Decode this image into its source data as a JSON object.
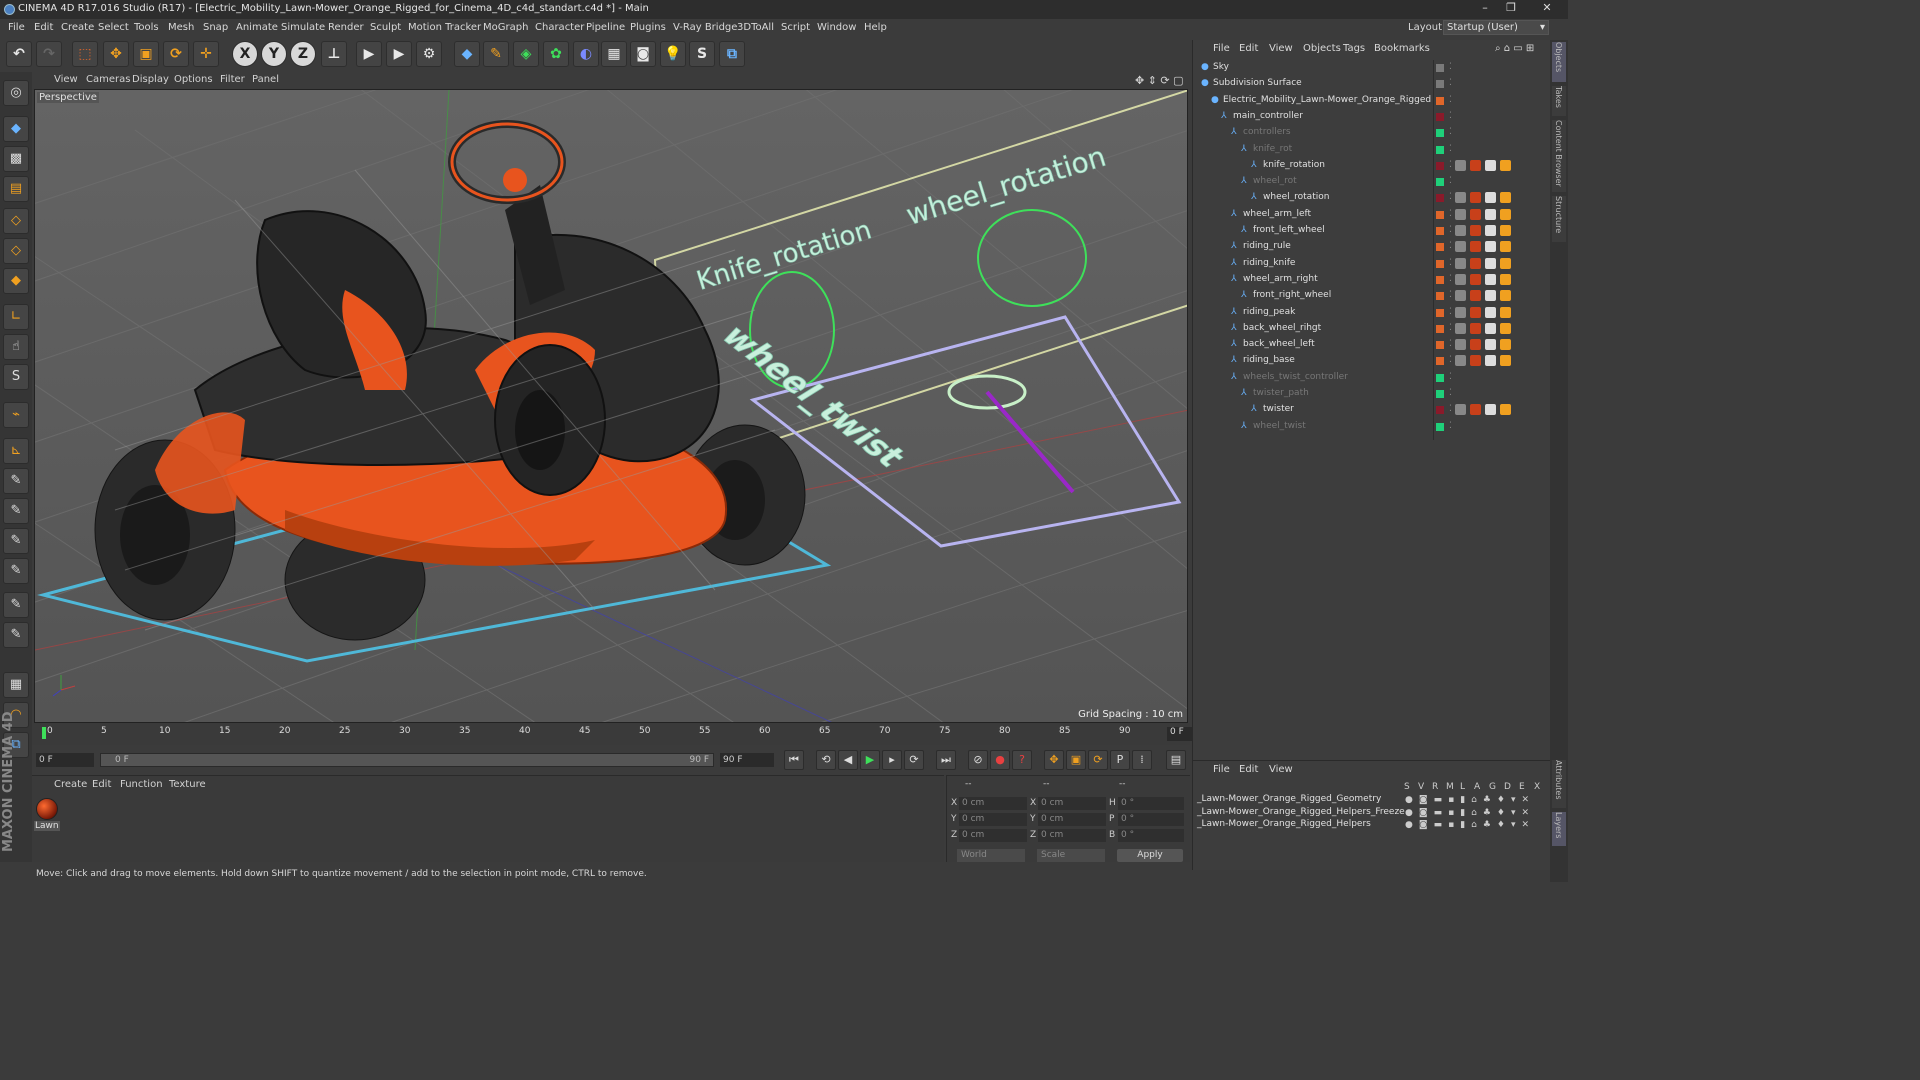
{
  "titlebar": {
    "title": "CINEMA 4D R17.016 Studio (R17) - [Electric_Mobility_Lawn-Mower_Orange_Rigged_for_Cinema_4D_c4d_standart.c4d *] - Main",
    "minimize": "–",
    "restore": "❐",
    "close": "✕"
  },
  "menubar": {
    "items": [
      "File",
      "Edit",
      "Create",
      "Select",
      "Tools",
      "Mesh",
      "Snap",
      "Animate",
      "Simulate",
      "Render",
      "Sculpt",
      "Motion Tracker",
      "MoGraph",
      "Character",
      "Pipeline",
      "Plugins",
      "V-Ray Bridge",
      "3DToAll",
      "Script",
      "Window",
      "Help"
    ],
    "layout_label": "Layout:",
    "layout_value": "Startup (User)"
  },
  "toolbar": {
    "axis_x": "X",
    "axis_y": "Y",
    "axis_z": "Z"
  },
  "viewport": {
    "menus": [
      "View",
      "Cameras",
      "Display",
      "Options",
      "Filter",
      "Panel"
    ],
    "camera_label": "Perspective",
    "grid_spacing": "Grid Spacing : 10 cm",
    "scene_text": {
      "knife_label": "Knife_rotation",
      "wheel_label": "wheel_rotation",
      "twist_label": "wheel_twist"
    }
  },
  "timeline": {
    "ticks": [
      "0",
      "5",
      "10",
      "15",
      "20",
      "25",
      "30",
      "35",
      "40",
      "45",
      "50",
      "55",
      "60",
      "65",
      "70",
      "75",
      "80",
      "85",
      "90"
    ],
    "current_frame": "0 F"
  },
  "transport": {
    "start_field": "0 F",
    "slider_start": "0 F",
    "slider_end": "90 F",
    "end_field": "90 F"
  },
  "material_panel": {
    "menus": [
      "Create",
      "Edit",
      "Function",
      "Texture"
    ],
    "material_name": "Lawn"
  },
  "coords_panel": {
    "header_pos": "--",
    "header_size": "--",
    "header_rot": "--",
    "rows": [
      {
        "axis": "X",
        "pos": "0 cm",
        "size_axis": "X",
        "size": "0 cm",
        "rot_axis": "H",
        "rot": "0 °"
      },
      {
        "axis": "Y",
        "pos": "0 cm",
        "size_axis": "Y",
        "size": "0 cm",
        "rot_axis": "P",
        "rot": "0 °"
      },
      {
        "axis": "Z",
        "pos": "0 cm",
        "size_axis": "Z",
        "size": "0 cm",
        "rot_axis": "B",
        "rot": "0 °"
      }
    ],
    "coord_system": "World",
    "mode": "Scale",
    "apply": "Apply"
  },
  "status": {
    "text": "Move: Click and drag to move elements. Hold down SHIFT to quantize movement / add to the selection in point mode, CTRL to remove."
  },
  "objects_panel": {
    "menus": [
      "File",
      "Edit",
      "View",
      "Objects",
      "Tags",
      "Bookmarks"
    ],
    "objects": [
      {
        "name": "Sky",
        "depth": 0,
        "dim": false,
        "color": "#7a7a7a"
      },
      {
        "name": "Subdivision Surface",
        "depth": 0,
        "dim": false,
        "color": "#7a7a7a"
      },
      {
        "name": "Electric_Mobility_Lawn-Mower_Orange_Rigged",
        "depth": 1,
        "dim": false,
        "color": "#e0662a"
      },
      {
        "name": "main_controller",
        "depth": 2,
        "dim": false,
        "color": "#8a1a2a"
      },
      {
        "name": "controllers",
        "depth": 3,
        "dim": true,
        "color": "#1fd07a"
      },
      {
        "name": "knife_rot",
        "depth": 4,
        "dim": true,
        "color": "#1fd07a"
      },
      {
        "name": "knife_rotation",
        "depth": 5,
        "dim": false,
        "color": "#8a1a2a"
      },
      {
        "name": "wheel_rot",
        "depth": 4,
        "dim": true,
        "color": "#1fd07a"
      },
      {
        "name": "wheel_rotation",
        "depth": 5,
        "dim": false,
        "color": "#8a1a2a"
      },
      {
        "name": "wheel_arm_left",
        "depth": 3,
        "dim": false,
        "color": "#e0662a"
      },
      {
        "name": "front_left_wheel",
        "depth": 4,
        "dim": false,
        "color": "#e0662a"
      },
      {
        "name": "riding_rule",
        "depth": 3,
        "dim": false,
        "color": "#e0662a"
      },
      {
        "name": "riding_knife",
        "depth": 3,
        "dim": false,
        "color": "#e0662a"
      },
      {
        "name": "wheel_arm_right",
        "depth": 3,
        "dim": false,
        "color": "#e0662a"
      },
      {
        "name": "front_right_wheel",
        "depth": 4,
        "dim": false,
        "color": "#e0662a"
      },
      {
        "name": "riding_peak",
        "depth": 3,
        "dim": false,
        "color": "#e0662a"
      },
      {
        "name": "back_wheel_rihgt",
        "depth": 3,
        "dim": false,
        "color": "#e0662a"
      },
      {
        "name": "back_wheel_left",
        "depth": 3,
        "dim": false,
        "color": "#e0662a"
      },
      {
        "name": "riding_base",
        "depth": 3,
        "dim": false,
        "color": "#e0662a"
      },
      {
        "name": "wheels_twist_controller",
        "depth": 3,
        "dim": true,
        "color": "#1fd07a"
      },
      {
        "name": "twister_path",
        "depth": 4,
        "dim": true,
        "color": "#1fd07a"
      },
      {
        "name": "twister",
        "depth": 5,
        "dim": false,
        "color": "#8a1a2a"
      },
      {
        "name": "wheel_twist",
        "depth": 4,
        "dim": true,
        "color": "#1fd07a"
      }
    ]
  },
  "layers_panel": {
    "menus": [
      "File",
      "Edit",
      "View"
    ],
    "columns": [
      "S",
      "V",
      "R",
      "M",
      "L",
      "A",
      "G",
      "D",
      "E",
      "X"
    ],
    "layers": [
      {
        "name": "_Lawn-Mower_Orange_Rigged_Geometry"
      },
      {
        "name": "_Lawn-Mower_Orange_Rigged_Helpers_Freeze"
      },
      {
        "name": "_Lawn-Mower_Orange_Rigged_Helpers"
      }
    ]
  },
  "right_tabs": [
    "Objects",
    "Takes",
    "Content Browser",
    "Structure",
    "Attributes",
    "Layers"
  ],
  "branding": "MAXON CINEMA 4D",
  "colors": {
    "accent_orange": "#e0662a",
    "viewport_bg": "#5c5c5c",
    "controller_green": "#3ee05a",
    "cyan_plane": "#4fb8d8",
    "helper_lavender": "#b8b4f0"
  }
}
